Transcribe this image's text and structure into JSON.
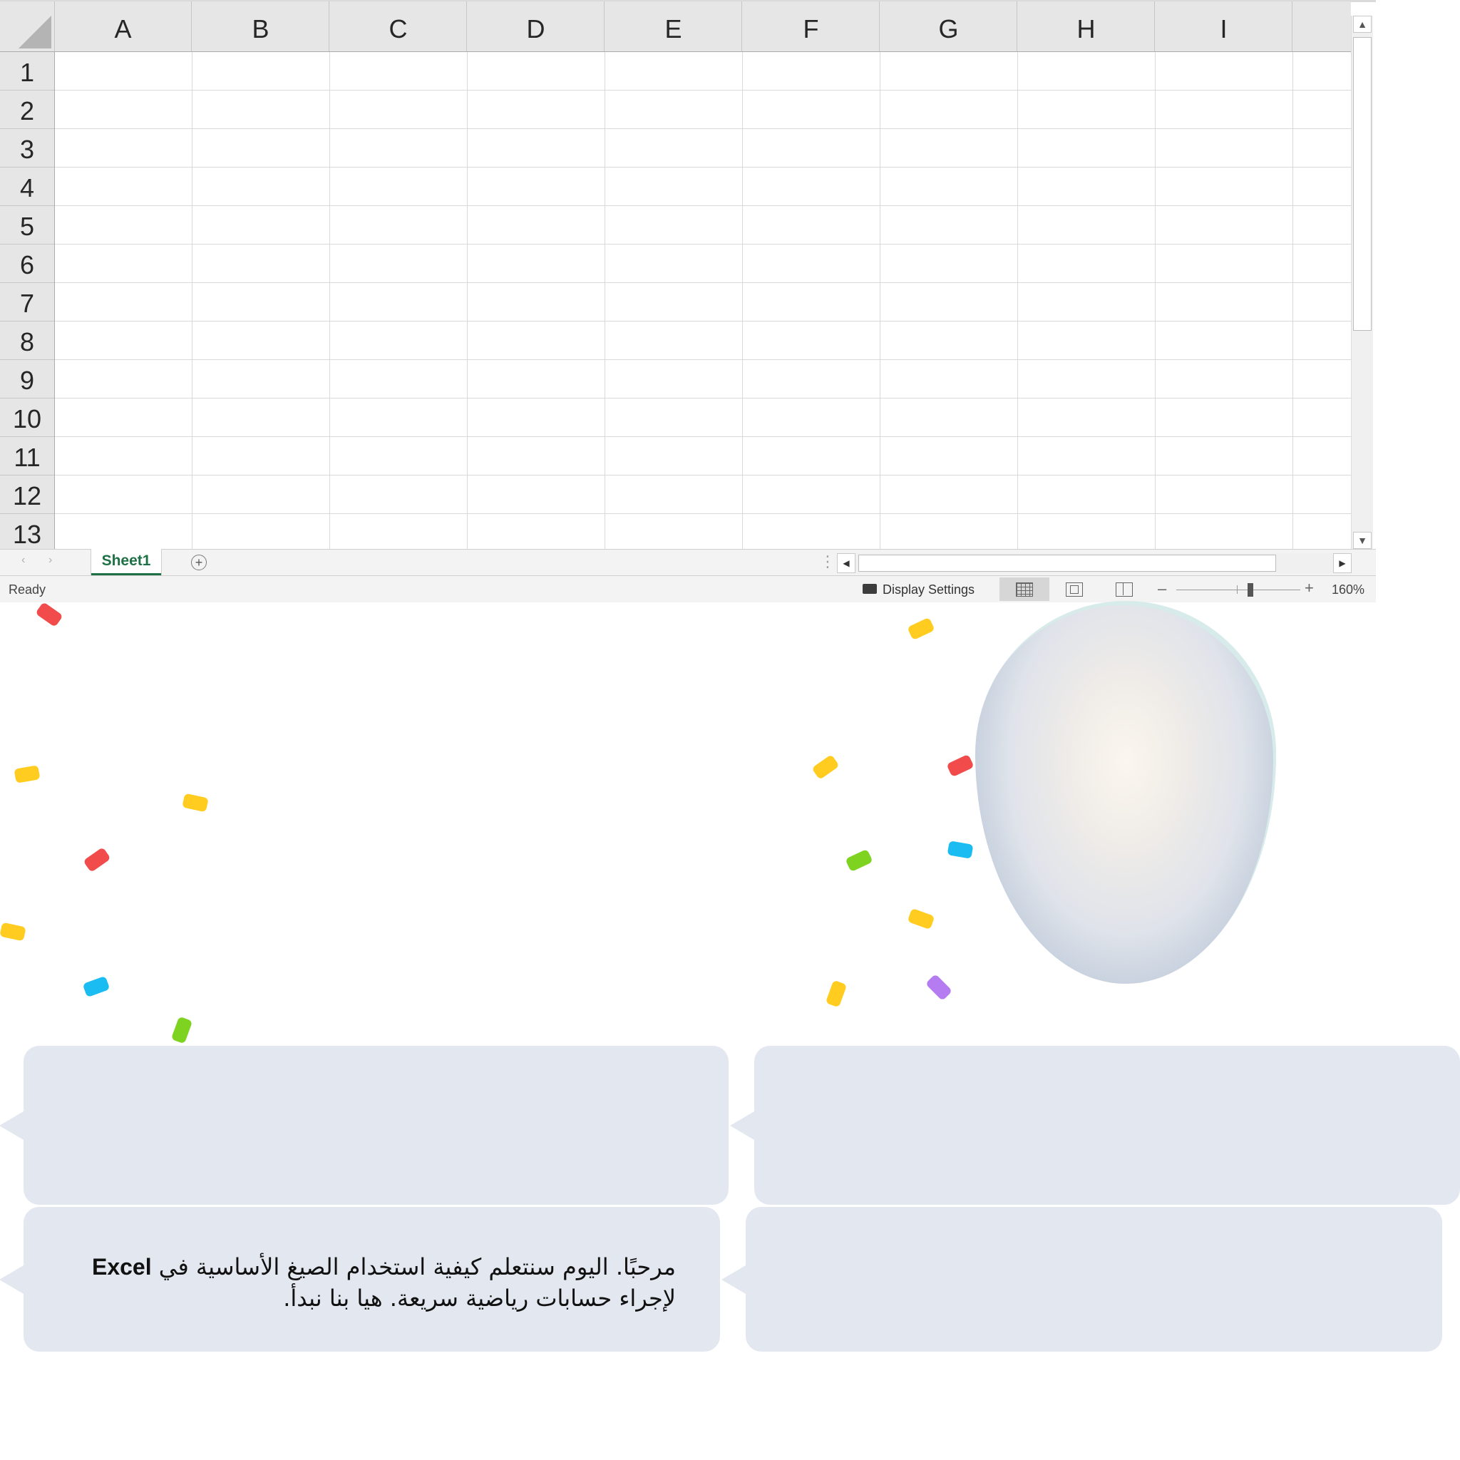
{
  "spreadsheet": {
    "columns": [
      "A",
      "B",
      "C",
      "D",
      "E",
      "F",
      "G",
      "H",
      "I"
    ],
    "rows": [
      "1",
      "2",
      "3",
      "4",
      "5",
      "6",
      "7",
      "8",
      "9",
      "10",
      "11",
      "12",
      "13"
    ],
    "sheet_tab": "Sheet1",
    "add_sheet_glyph": "⊕",
    "split_glyph": "⋮"
  },
  "status_bar": {
    "status": "Ready",
    "display_settings": "Display Settings",
    "zoom_minus": "–",
    "zoom_plus": "+",
    "zoom_level": "160%"
  },
  "scroll_glyphs": {
    "up": "▲",
    "down": "▼",
    "left": "◀",
    "right": "▶",
    "prev_sheet": "‹",
    "next_sheet": "›"
  },
  "dialogue": {
    "message_before": "مرحبًا. اليوم سنتعلم كيفية استخدام الصيغ الأساسية في",
    "message_brand": "Excel",
    "message_after": "لإجراء حسابات رياضية سريعة. هيا بنا نبدأ."
  },
  "colors": {
    "confetti": [
      "#f24b4b",
      "#ffcc1f",
      "#1bbcf2",
      "#7ed321",
      "#b57bf0"
    ],
    "bubble": "#e3e7ef",
    "excel_green": "#1e7145"
  },
  "icons": [
    "select-all-corner-icon",
    "add-sheet-icon",
    "display-settings-icon",
    "normal-view-icon",
    "page-layout-view-icon",
    "page-break-view-icon"
  ]
}
